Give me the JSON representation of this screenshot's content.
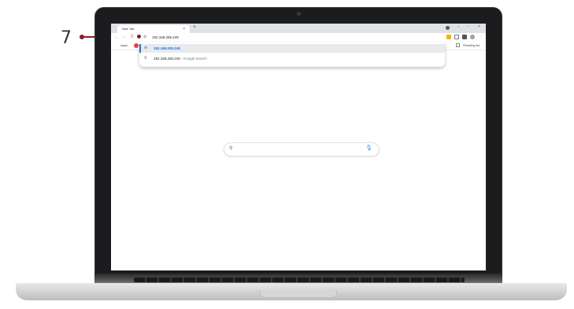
{
  "callout": {
    "number": "7",
    "color": "#8b1a2b"
  },
  "browser": {
    "tab": {
      "title": "New Tab",
      "close": "×"
    },
    "new_tab": "+",
    "window_controls": {
      "minimize": "−",
      "maximize": "▫",
      "close": "×"
    },
    "toolbar": {
      "back": "←",
      "forward": "→",
      "reload": "C",
      "address_value": "192.168.255.249",
      "menu": "⋮"
    },
    "bookmarks": {
      "apps_label": "Apps",
      "reading_list": "Reading list"
    },
    "suggestions": [
      {
        "text": "192.168.255.249",
        "suffix": "",
        "icon": "globe-icon",
        "selected": true
      },
      {
        "text": "192.168.255.249",
        "suffix": " - Google Search",
        "icon": "search-icon",
        "selected": false
      }
    ]
  },
  "colors": {
    "accent": "#1a73e8",
    "bookmark_dot": "#ea4335",
    "mic": "#4285f4"
  }
}
